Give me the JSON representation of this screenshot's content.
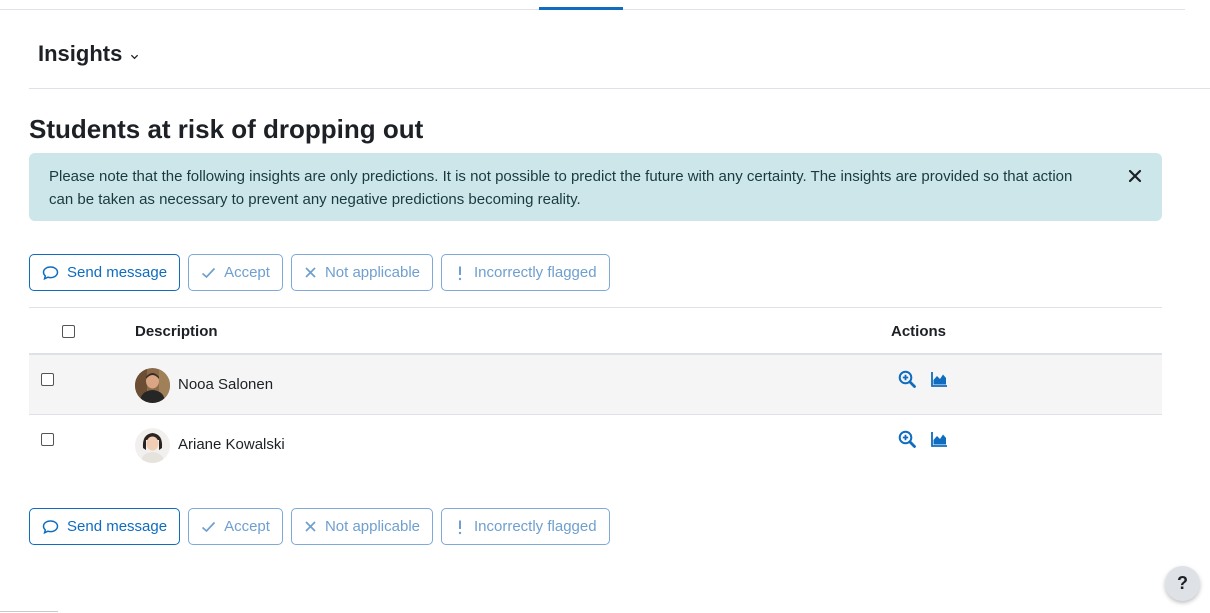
{
  "report": {
    "title": "Insights"
  },
  "page": {
    "heading": "Students at risk of dropping out"
  },
  "alert": {
    "message": "Please note that the following insights are only predictions. It is not possible to predict the future with any certainty. The insights are provided so that action can be taken as necessary to prevent any negative predictions becoming reality."
  },
  "actions": {
    "send_message": "Send message",
    "accept": "Accept",
    "not_applicable": "Not applicable",
    "incorrectly_flagged": "Incorrectly flagged"
  },
  "table": {
    "headers": {
      "description": "Description",
      "actions": "Actions"
    },
    "rows": [
      {
        "name": "Nooa Salonen",
        "icons": [
          "zoom-in-icon",
          "area-chart-icon"
        ]
      },
      {
        "name": "Ariane Kowalski",
        "icons": [
          "zoom-in-icon",
          "area-chart-icon"
        ]
      }
    ]
  },
  "help": {
    "label": "?"
  },
  "colors": {
    "primary": "#0f6cbf",
    "alert_bg": "#cce6ea",
    "alert_text": "#1a3a40"
  }
}
